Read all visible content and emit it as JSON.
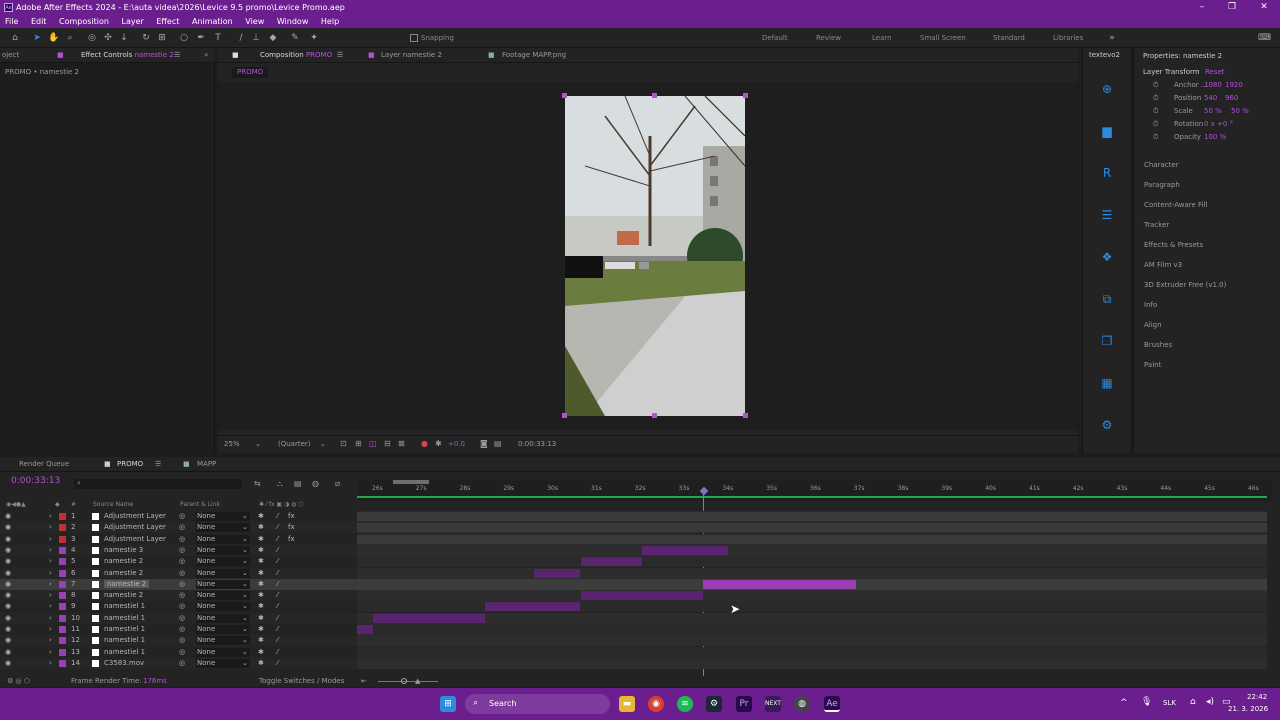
{
  "app": {
    "title": "Adobe After Effects 2024 - E:\\auta videa\\2026\\Levice 9.5 promo\\Levice Promo.aep"
  },
  "menu": [
    "File",
    "Edit",
    "Composition",
    "Layer",
    "Effect",
    "Animation",
    "View",
    "Window",
    "Help"
  ],
  "toolbar": {
    "snapping_label": "Snapping"
  },
  "workspaces": [
    "Default",
    "Review",
    "Learn",
    "Small Screen",
    "Standard",
    "Libraries"
  ],
  "left_panel": {
    "tab_project": "oject",
    "tab_effect_controls": "Effect Controls",
    "tab_effect_controls_layer": "namestie 2",
    "breadcrumb": "PROMO • namestie 2"
  },
  "comp_panel": {
    "tab_comp": "Composition",
    "tab_comp_name": "PROMO",
    "tab_layer": "Layer namestie 2",
    "tab_footage": "Footage MAPP.png",
    "sub_tab": "PROMO"
  },
  "viewer_footer": {
    "zoom": "25%",
    "resolution": "(Quarter)",
    "exposure": "+0.0",
    "timecode": "0:00:33:13"
  },
  "right_strip": {
    "tab": "textevo2"
  },
  "properties": {
    "title": "Properties: namestie 2",
    "section": "Layer Transform",
    "reset": "Reset",
    "rows": [
      {
        "name": "Anchor ...",
        "v1": "1080",
        "v2": "1920"
      },
      {
        "name": "Position",
        "v1": "540",
        "v2": "960"
      },
      {
        "name": "Scale",
        "v1": "50 %",
        "v2": "50 %"
      },
      {
        "name": "Rotation",
        "v1": "0 x +0 °",
        "v2": ""
      },
      {
        "name": "Opacity",
        "v1": "100 %",
        "v2": ""
      }
    ],
    "panels": [
      "Character",
      "Paragraph",
      "Content-Aware Fill",
      "Tracker",
      "Effects & Presets",
      "AM Film v3",
      "3D Extruder Free (v1.0)",
      "Info",
      "Align",
      "Brushes",
      "Paint"
    ]
  },
  "timeline": {
    "tabs": {
      "render_queue": "Render Queue",
      "promo": "PROMO",
      "mapp": "MAPP"
    },
    "timecode": "0:00:33:13",
    "col_headers": {
      "num": "#",
      "source": "Source Name",
      "parent": "Parent & Link"
    },
    "ruler": [
      "26s",
      "27s",
      "28s",
      "29s",
      "30s",
      "31s",
      "32s",
      "33s",
      "34s",
      "35s",
      "36s",
      "37s",
      "38s",
      "39s",
      "40s",
      "41s",
      "42s",
      "43s",
      "44s",
      "45s",
      "46s"
    ],
    "layers": [
      {
        "num": "1",
        "name": "Adjustment Layer",
        "parent": "None",
        "color": "#c23030",
        "bar_start": 0,
        "bar_end": 1,
        "selected": false,
        "fx": true
      },
      {
        "num": "2",
        "name": "Adjustment Layer",
        "parent": "None",
        "color": "#c23030",
        "bar_start": 0,
        "bar_end": 1,
        "selected": false,
        "fx": true
      },
      {
        "num": "3",
        "name": "Adjustment Layer",
        "parent": "None",
        "color": "#c23030",
        "bar_start": 0,
        "bar_end": 1,
        "selected": false,
        "fx": true
      },
      {
        "num": "4",
        "name": "namestie 3",
        "parent": "None",
        "color": "#9b3fb5",
        "bar_start": 0.313,
        "bar_end": 0.408,
        "selected": false,
        "fx": false
      },
      {
        "num": "5",
        "name": "namestie 2",
        "parent": "None",
        "color": "#9b3fb5",
        "bar_start": 0.246,
        "bar_end": 0.313,
        "selected": false,
        "fx": false
      },
      {
        "num": "6",
        "name": "namestie 2",
        "parent": "None",
        "color": "#9b3fb5",
        "bar_start": 0.195,
        "bar_end": 0.245,
        "selected": false,
        "fx": false
      },
      {
        "num": "7",
        "name": "namestie 2",
        "parent": "None",
        "color": "#9b3fb5",
        "bar_start": 0.38,
        "bar_end": 0.548,
        "selected": true,
        "fx": false
      },
      {
        "num": "8",
        "name": "namestie 2",
        "parent": "None",
        "color": "#9b3fb5",
        "bar_start": 0.246,
        "bar_end": 0.38,
        "selected": false,
        "fx": false
      },
      {
        "num": "9",
        "name": "namestiel 1",
        "parent": "None",
        "color": "#9b3fb5",
        "bar_start": 0.141,
        "bar_end": 0.245,
        "selected": false,
        "fx": false
      },
      {
        "num": "10",
        "name": "namestiel 1",
        "parent": "None",
        "color": "#9b3fb5",
        "bar_start": 0.018,
        "bar_end": 0.141,
        "selected": false,
        "fx": false
      },
      {
        "num": "11",
        "name": "namestiel 1",
        "parent": "None",
        "color": "#9b3fb5",
        "bar_start": 0.0,
        "bar_end": 0.018,
        "selected": false,
        "fx": false
      },
      {
        "num": "12",
        "name": "namestiel 1",
        "parent": "None",
        "color": "#9b3fb5",
        "bar_start": 0,
        "bar_end": 0,
        "selected": false,
        "fx": false
      },
      {
        "num": "13",
        "name": "namestiel 1",
        "parent": "None",
        "color": "#9b3fb5",
        "bar_start": 0,
        "bar_end": 0,
        "selected": false,
        "fx": false
      },
      {
        "num": "14",
        "name": "C3583.mov",
        "parent": "None",
        "color": "#9b3fb5",
        "bar_start": 0,
        "bar_end": 0,
        "selected": false,
        "fx": false
      }
    ],
    "footer": {
      "render_time_label": "Frame Render Time:",
      "render_time": "176ms",
      "toggle": "Toggle Switches / Modes"
    }
  },
  "taskbar": {
    "search": "Search",
    "lang": "SLK",
    "time": "22:42",
    "date": "21. 3. 2026"
  },
  "colors": {
    "accent": "#b64fd8",
    "title_bar": "#6b1f8f",
    "icon_blue": "#2e8be0"
  }
}
